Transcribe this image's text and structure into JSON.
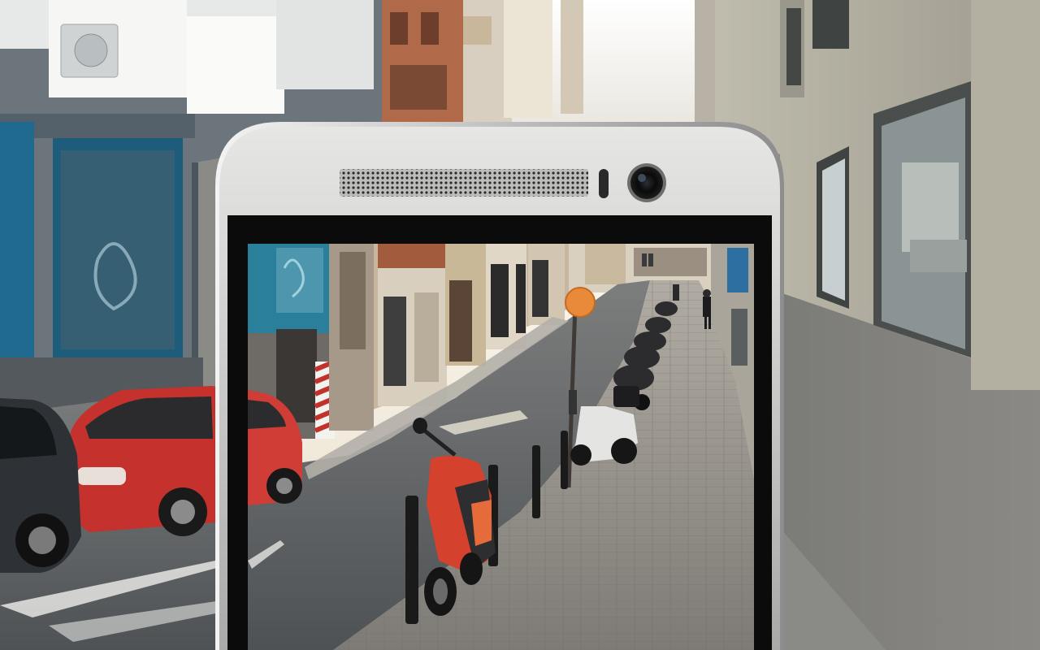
{
  "scene": {
    "subject": "smartphone",
    "background": "city-street",
    "colors": {
      "sky": "#f4f3ef",
      "left_building": "#5d6a73",
      "left_trim": "#1f6a8e",
      "right_building": "#aca99d",
      "sidewalk": "#8d8a84",
      "road": "#5e6265",
      "phone_body": "#c7c7c5",
      "phone_bezel": "#0b0b0b",
      "car_red": "#c5322d",
      "scooter_red": "#d4412c"
    },
    "icons": [
      "front-camera-icon",
      "speaker-grille-icon",
      "sensor-icon"
    ]
  }
}
